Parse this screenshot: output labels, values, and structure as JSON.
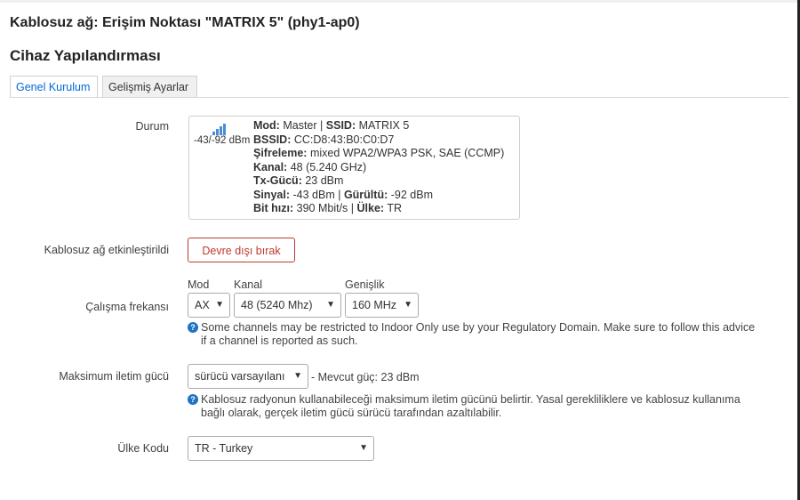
{
  "dialog": {
    "title": "Kablosuz ağ: Erişim Noktası \"MATRIX 5\" (phy1-ap0)",
    "section_title": "Cihaz Yapılandırması",
    "tabs": [
      {
        "label": "Genel Kurulum",
        "active": true
      },
      {
        "label": "Gelişmiş Ayarlar",
        "active": false
      }
    ]
  },
  "status": {
    "label": "Durum",
    "signal_icon": "signal-bars-icon",
    "dbm_text": "-43/-92 dBm",
    "mode_label": "Mod:",
    "mode_value": "Master",
    "ssid_label": "SSID:",
    "ssid_value": "MATRIX 5",
    "bssid_label": "BSSID:",
    "bssid_value": "CC:D8:43:B0:C0:D7",
    "encryption_label": "Şifreleme:",
    "encryption_value": "mixed WPA2/WPA3 PSK, SAE (CCMP)",
    "channel_label": "Kanal:",
    "channel_value": "48 (5.240 GHz)",
    "txpower_label": "Tx-Gücü:",
    "txpower_value": "23 dBm",
    "signal_label": "Sinyal:",
    "signal_value": "-43 dBm",
    "noise_label": "Gürültü:",
    "noise_value": "-92 dBm",
    "bitrate_label": "Bit hızı:",
    "bitrate_value": "390 Mbit/s",
    "country_label": "Ülke:",
    "country_value": "TR",
    "separator": "|"
  },
  "enabled": {
    "label": "Kablosuz ağ etkinleştirildi",
    "button_label": "Devre dışı bırak",
    "button_color": "#c0392b"
  },
  "frequency": {
    "label": "Çalışma frekansı",
    "mode_label": "Mod",
    "mode_value": "AX",
    "channel_label": "Kanal",
    "channel_value": "48 (5240 Mhz)",
    "width_label": "Genişlik",
    "width_value": "160 MHz",
    "help_line1": "Some channels may be restricted to Indoor Only use by your Regulatory Domain. Make sure to follow this advice",
    "help_line2": "if a channel is reported as such."
  },
  "txpower": {
    "label": "Maksimum iletim gücü",
    "select_value": "sürücü varsayılanı",
    "current_text": "- Mevcut güç: 23 dBm",
    "help_line1": "Kablosuz radyonun kullanabileceği maksimum iletim gücünü belirtir. Yasal gerekliliklere ve kablosuz kullanıma",
    "help_line2": "bağlı olarak, gerçek iletim gücü sürücü tarafından azaltılabilir."
  },
  "country": {
    "label": "Ülke Kodu",
    "select_value": "TR - Turkey"
  },
  "colors": {
    "accent": "#0069d6",
    "help_icon": "#1f72c4",
    "danger": "#c0392b"
  },
  "icons": {
    "chevron": "chevron-down-icon",
    "help": "help-icon",
    "help_glyph": "?"
  }
}
